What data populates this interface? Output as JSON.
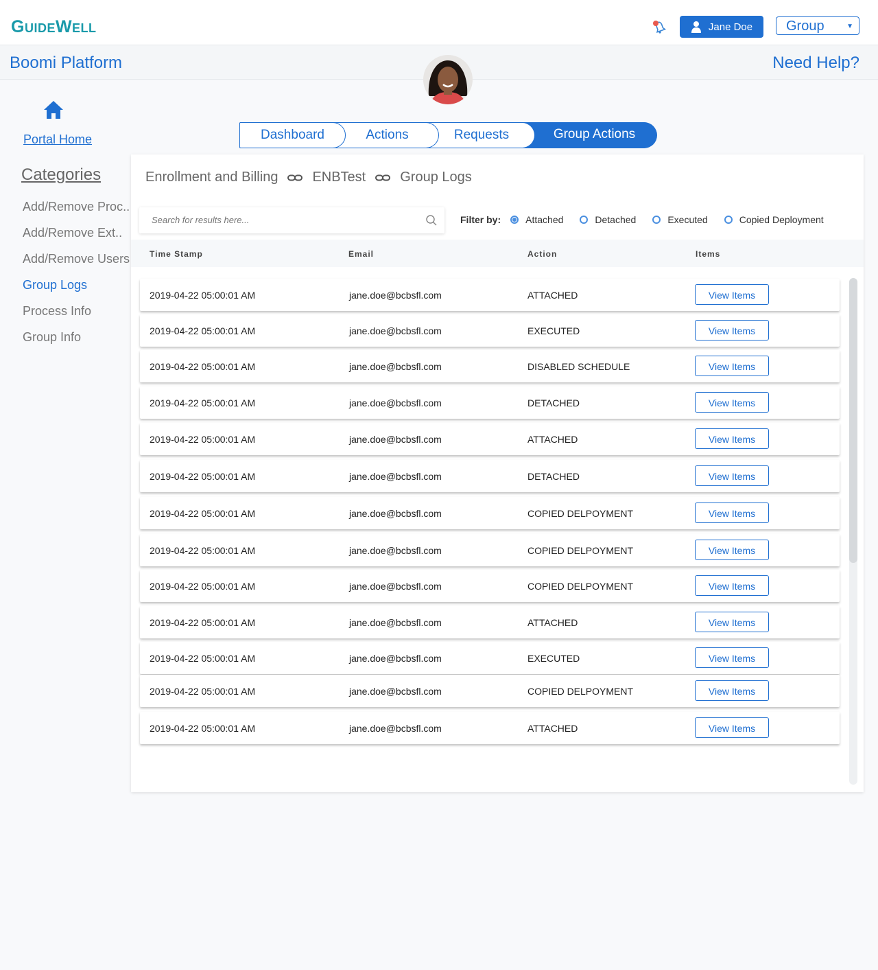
{
  "header": {
    "logo": "GuideWell",
    "user_name": "Jane Doe",
    "group_select": "Group"
  },
  "subheader": {
    "platform": "Boomi Platform",
    "help": "Need Help?"
  },
  "sidebar": {
    "home_label": "Portal Home",
    "categories_title": "Categories",
    "items": [
      {
        "label": "Add/Remove Proc.."
      },
      {
        "label": "Add/Remove Ext.."
      },
      {
        "label": "Add/Remove Users"
      },
      {
        "label": "Group Logs"
      },
      {
        "label": "Process Info"
      },
      {
        "label": "Group Info"
      }
    ]
  },
  "tabs": [
    "Dashboard",
    "Actions",
    "Requests",
    "Group Actions"
  ],
  "breadcrumb": [
    "Enrollment and Billing",
    "ENBTest",
    "Group Logs"
  ],
  "search": {
    "placeholder": "Search for results here..."
  },
  "filter": {
    "label": "Filter by:",
    "options": [
      "Attached",
      "Detached",
      "Executed",
      "Copied Deployment"
    ],
    "selected": "Attached"
  },
  "table": {
    "headers": [
      "Time Stamp",
      "Email",
      "Action",
      "Items"
    ],
    "button_label": "View Items",
    "rows": [
      {
        "timestamp": "2019-04-22 05:00:01 AM",
        "email": "jane.doe@bcbsfl.com",
        "action": "ATTACHED"
      },
      {
        "timestamp": "2019-04-22 05:00:01 AM",
        "email": "jane.doe@bcbsfl.com",
        "action": "EXECUTED"
      },
      {
        "timestamp": "2019-04-22 05:00:01 AM",
        "email": "jane.doe@bcbsfl.com",
        "action": "DISABLED SCHEDULE"
      },
      {
        "timestamp": "2019-04-22 05:00:01 AM",
        "email": "jane.doe@bcbsfl.com",
        "action": "DETACHED"
      },
      {
        "timestamp": "2019-04-22 05:00:01 AM",
        "email": "jane.doe@bcbsfl.com",
        "action": "ATTACHED"
      },
      {
        "timestamp": "2019-04-22 05:00:01 AM",
        "email": "jane.doe@bcbsfl.com",
        "action": "DETACHED"
      },
      {
        "timestamp": "2019-04-22 05:00:01 AM",
        "email": "jane.doe@bcbsfl.com",
        "action": "COPIED DELPOYMENT"
      },
      {
        "timestamp": "2019-04-22 05:00:01 AM",
        "email": "jane.doe@bcbsfl.com",
        "action": "COPIED DELPOYMENT"
      },
      {
        "timestamp": "2019-04-22 05:00:01 AM",
        "email": "jane.doe@bcbsfl.com",
        "action": "COPIED DELPOYMENT"
      },
      {
        "timestamp": "2019-04-22 05:00:01 AM",
        "email": "jane.doe@bcbsfl.com",
        "action": "ATTACHED"
      },
      {
        "timestamp": "2019-04-22 05:00:01 AM",
        "email": "jane.doe@bcbsfl.com",
        "action": "EXECUTED"
      },
      {
        "timestamp": "2019-04-22 05:00:01 AM",
        "email": "jane.doe@bcbsfl.com",
        "action": "COPIED DELPOYMENT"
      },
      {
        "timestamp": "2019-04-22 05:00:01 AM",
        "email": "jane.doe@bcbsfl.com",
        "action": "ATTACHED"
      }
    ]
  },
  "colors": {
    "accent": "#1f6fd1",
    "logo": "#1a9aaa",
    "notification": "#e85a4f"
  },
  "icons": [
    "bell-icon",
    "user-icon",
    "home-icon",
    "search-icon",
    "link-icon",
    "chevron-down-icon"
  ]
}
